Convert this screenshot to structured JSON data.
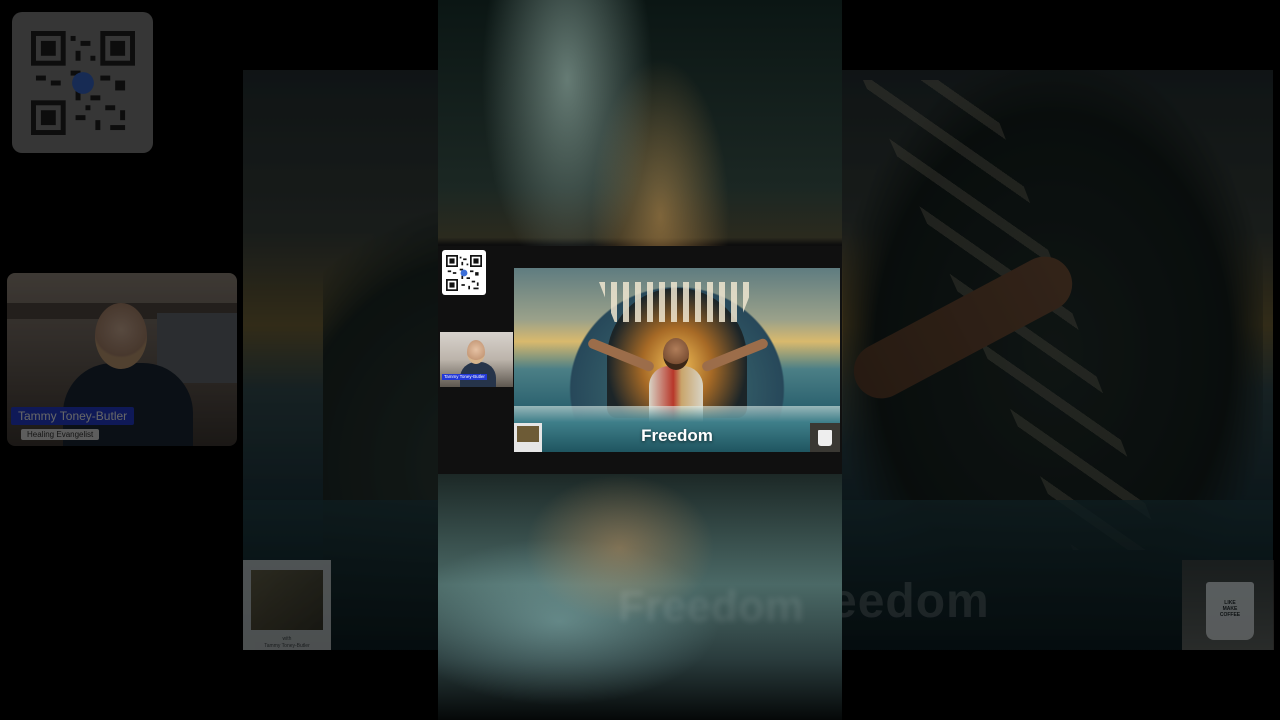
{
  "background": {
    "caption": "Freedom",
    "speaker_name": "Tammy Toney-Butler",
    "speaker_title": "Healing Evangelist",
    "book_label": "with\nTammy Toney-Butler",
    "mug_text": "LIKE\nMAKE\nCOFFEE"
  },
  "stage": {
    "caption": "Freedom",
    "speaker_name": "Tammy Toney-Butler"
  },
  "icons": [
    "qr-code-icon"
  ],
  "colors": {
    "name_tag": "#2640d8",
    "caption_text": "#ffffff",
    "backdrop": "#000000"
  }
}
